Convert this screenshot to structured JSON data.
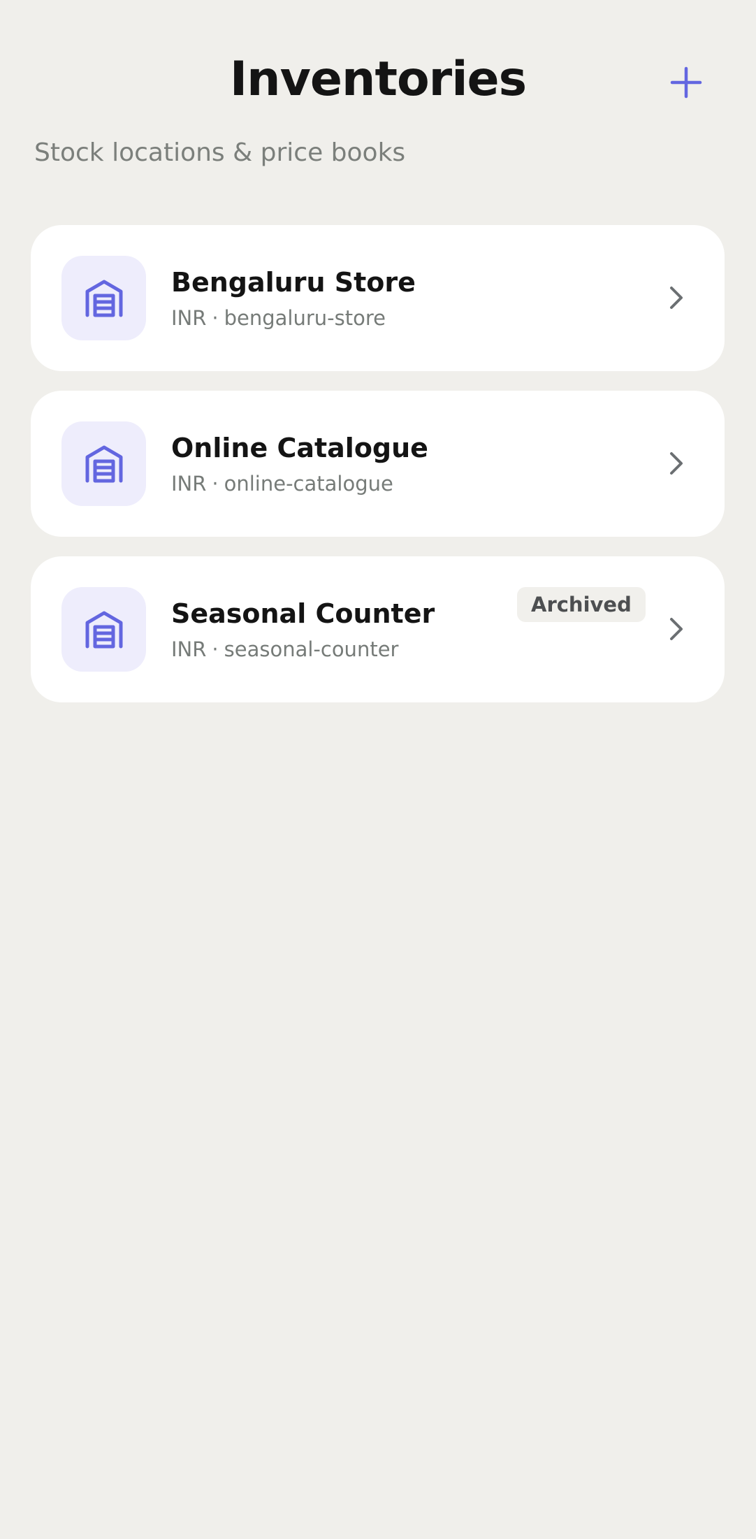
{
  "header": {
    "title": "Inventories",
    "subtitle": "Stock locations & price books",
    "add_icon": "plus-icon"
  },
  "colors": {
    "background": "#f0efeb",
    "accent": "#6366e0",
    "icon_tile": "#eeedfc",
    "card": "#ffffff",
    "title_text": "#141414",
    "muted_text": "#767b78"
  },
  "inventories": [
    {
      "name": "Bengaluru Store",
      "currency": "INR",
      "separator": "·",
      "slug": "bengaluru-store",
      "icon": "warehouse-icon",
      "badge": ""
    },
    {
      "name": "Online Catalogue",
      "currency": "INR",
      "separator": "·",
      "slug": "online-catalogue",
      "icon": "warehouse-icon",
      "badge": ""
    },
    {
      "name": "Seasonal Counter",
      "currency": "INR",
      "separator": "·",
      "slug": "seasonal-counter",
      "icon": "warehouse-icon",
      "badge": "Archived"
    }
  ]
}
